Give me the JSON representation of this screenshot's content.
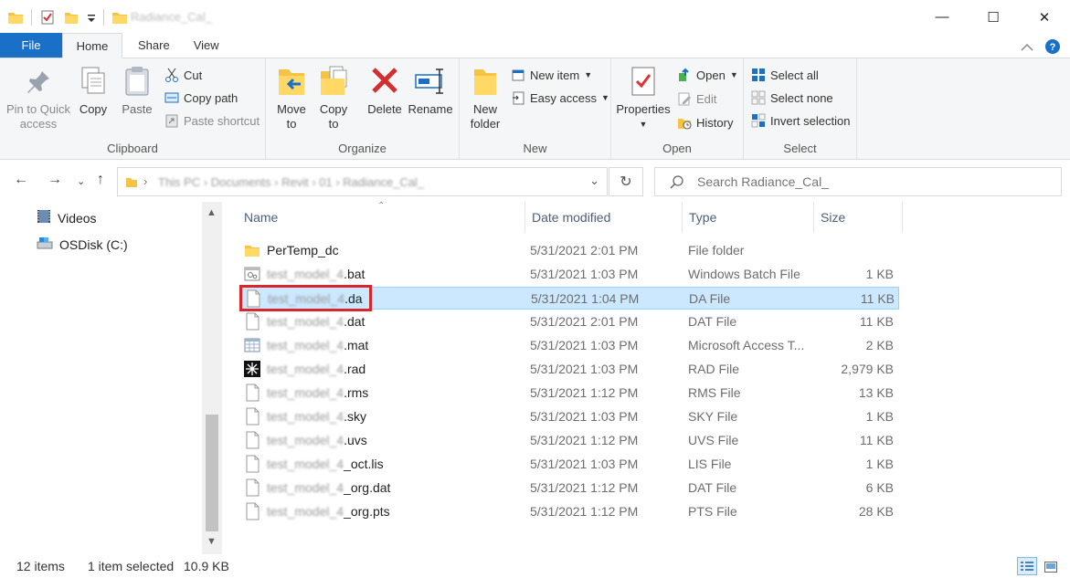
{
  "window": {
    "title": "Radiance_Cal_",
    "minimize": "—",
    "maximize": "☐",
    "close": "✕"
  },
  "tabs": [
    "File",
    "Home",
    "Share",
    "View"
  ],
  "ribbon": {
    "clipboard": {
      "label": "Clipboard",
      "pin": "Pin to Quick access",
      "copy": "Copy",
      "paste": "Paste",
      "cut": "Cut",
      "copy_path": "Copy path",
      "paste_shortcut": "Paste shortcut"
    },
    "organize": {
      "label": "Organize",
      "move_to": "Move to",
      "copy_to": "Copy to",
      "delete": "Delete",
      "rename": "Rename"
    },
    "new": {
      "label": "New",
      "new_folder": "New folder",
      "new_item": "New item",
      "easy_access": "Easy access"
    },
    "open": {
      "label": "Open",
      "properties": "Properties",
      "open": "Open",
      "edit": "Edit",
      "history": "History"
    },
    "select": {
      "label": "Select",
      "select_all": "Select all",
      "select_none": "Select none",
      "invert": "Invert selection"
    }
  },
  "address": {
    "path": "This PC  ›  Documents  ›  Revit  ›  01  ›  Radiance_Cal_"
  },
  "search": {
    "placeholder": "Search Radiance_Cal_"
  },
  "navpane": {
    "items": [
      "Videos",
      "OSDisk (C:)"
    ]
  },
  "columns": {
    "name": "Name",
    "date": "Date modified",
    "type": "Type",
    "size": "Size"
  },
  "files": [
    {
      "prefix": "",
      "name": "PerTemp_dc",
      "date": "5/31/2021 2:01 PM",
      "type": "File folder",
      "size": "",
      "icon": "folder-icon",
      "selected": false
    },
    {
      "prefix": "test_model_4",
      "name": ".bat",
      "date": "5/31/2021 1:03 PM",
      "type": "Windows Batch File",
      "size": "1 KB",
      "icon": "batch-file-icon",
      "selected": false
    },
    {
      "prefix": "test_model_4",
      "name": ".da",
      "date": "5/31/2021 1:04 PM",
      "type": "DA File",
      "size": "11 KB",
      "icon": "blank-file-icon",
      "selected": true
    },
    {
      "prefix": "test_model_4",
      "name": ".dat",
      "date": "5/31/2021 2:01 PM",
      "type": "DAT File",
      "size": "11 KB",
      "icon": "blank-file-icon",
      "selected": false
    },
    {
      "prefix": "test_model_4",
      "name": ".mat",
      "date": "5/31/2021 1:03 PM",
      "type": "Microsoft Access T...",
      "size": "2 KB",
      "icon": "table-file-icon",
      "selected": false
    },
    {
      "prefix": "test_model_4",
      "name": ".rad",
      "date": "5/31/2021 1:03 PM",
      "type": "RAD File",
      "size": "2,979 KB",
      "icon": "radiance-file-icon",
      "selected": false
    },
    {
      "prefix": "test_model_4",
      "name": ".rms",
      "date": "5/31/2021 1:12 PM",
      "type": "RMS File",
      "size": "13 KB",
      "icon": "blank-file-icon",
      "selected": false
    },
    {
      "prefix": "test_model_4",
      "name": ".sky",
      "date": "5/31/2021 1:03 PM",
      "type": "SKY File",
      "size": "1 KB",
      "icon": "blank-file-icon",
      "selected": false
    },
    {
      "prefix": "test_model_4",
      "name": ".uvs",
      "date": "5/31/2021 1:12 PM",
      "type": "UVS File",
      "size": "11 KB",
      "icon": "blank-file-icon",
      "selected": false
    },
    {
      "prefix": "test_model_4",
      "name": "_oct.lis",
      "date": "5/31/2021 1:03 PM",
      "type": "LIS File",
      "size": "1 KB",
      "icon": "blank-file-icon",
      "selected": false
    },
    {
      "prefix": "test_model_4",
      "name": "_org.dat",
      "date": "5/31/2021 1:12 PM",
      "type": "DAT File",
      "size": "6 KB",
      "icon": "blank-file-icon",
      "selected": false
    },
    {
      "prefix": "test_model_4",
      "name": "_org.pts",
      "date": "5/31/2021 1:12 PM",
      "type": "PTS File",
      "size": "28 KB",
      "icon": "blank-file-icon",
      "selected": false
    }
  ],
  "status": {
    "count": "12 items",
    "selection": "1 item selected",
    "size": "10.9 KB"
  },
  "colors": {
    "file_tab": "#1a6fc7",
    "selected_row": "#cce8ff",
    "selected_border": "#99d1ff",
    "highlight_box": "#d9262c"
  }
}
